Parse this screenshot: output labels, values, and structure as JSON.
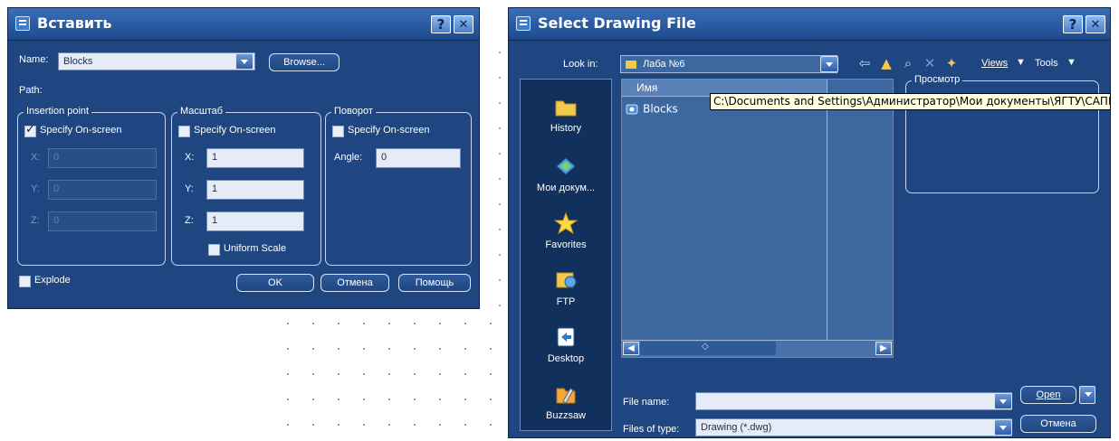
{
  "insert_dialog": {
    "title": "Вставить",
    "help_label": "?",
    "close_label": "✕",
    "name_label": "Name:",
    "name_value": "Blocks",
    "browse_label": "Browse...",
    "path_label": "Path:",
    "insertion_point": {
      "title": "Insertion point",
      "specify_label": "Specify On-screen",
      "specify_checked": true,
      "x_label": "X:",
      "x_value": "0",
      "y_label": "Y:",
      "y_value": "0",
      "z_label": "Z:",
      "z_value": "0"
    },
    "scale": {
      "title": "Масштаб",
      "specify_label": "Specify On-screen",
      "specify_checked": false,
      "x_label": "X:",
      "x_value": "1",
      "y_label": "Y:",
      "y_value": "1",
      "z_label": "Z:",
      "z_value": "1",
      "uniform_label": "Uniform Scale",
      "uniform_checked": false
    },
    "rotation": {
      "title": "Поворот",
      "specify_label": "Specify On-screen",
      "specify_checked": false,
      "angle_label": "Angle:",
      "angle_value": "0"
    },
    "explode_label": "Explode",
    "explode_checked": false,
    "ok_label": "OK",
    "cancel_label": "Отмена",
    "help_button_label": "Помощь"
  },
  "select_dialog": {
    "title": "Select Drawing File",
    "help_label": "?",
    "close_label": "✕",
    "look_in_label": "Look in:",
    "look_in_value": "Лаба №6",
    "views_label": "Views",
    "tools_label": "Tools",
    "preview_title": "Просмотр",
    "places": [
      {
        "label": "History",
        "icon": "history-icon"
      },
      {
        "label": "Мои докум...",
        "icon": "my-documents-icon"
      },
      {
        "label": "Favorites",
        "icon": "favorites-icon"
      },
      {
        "label": "FTP",
        "icon": "ftp-icon"
      },
      {
        "label": "Desktop",
        "icon": "desktop-icon"
      },
      {
        "label": "Buzzsaw",
        "icon": "buzzsaw-icon"
      }
    ],
    "list_header": "Имя",
    "files": [
      {
        "name": "Blocks",
        "icon": "folder-icon"
      }
    ],
    "tooltip": "C:\\Documents and Settings\\Администратор\\Мои документы\\ЯГТУ\\САПР",
    "scroll_thumb": "◇",
    "file_name_label": "File name:",
    "file_name_value": "",
    "files_of_type_label": "Files of type:",
    "files_of_type_value": "Drawing (*.dwg)",
    "open_label": "Open",
    "cancel_label": "Отмена"
  },
  "colors": {
    "dialog_body": "#1f4680",
    "title_gradient_top": "#3b6fb8",
    "field_bg": "#e6ecf7",
    "tooltip_bg": "#ffffe1"
  }
}
